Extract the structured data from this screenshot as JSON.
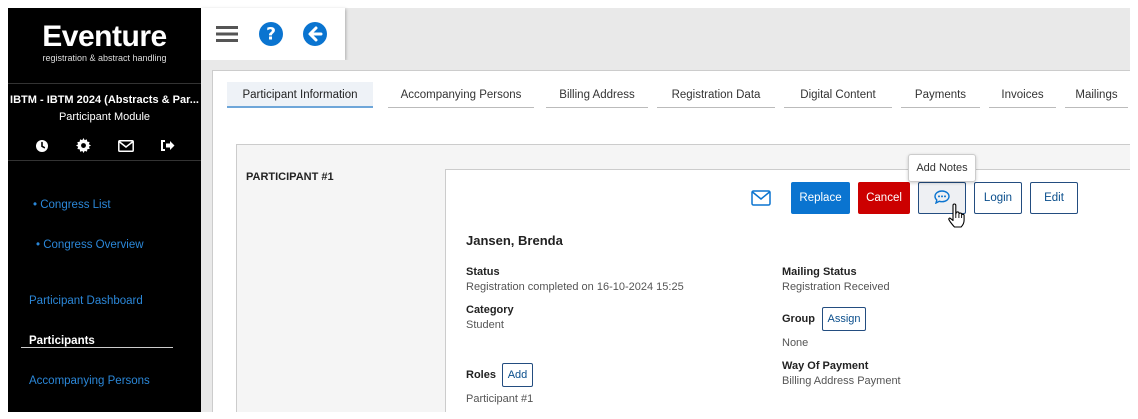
{
  "sidebar": {
    "logo_title": "Eventure",
    "logo_subtitle": "registration & abstract handling",
    "event_name": "IBTM - IBTM 2024 (Abstracts & Par...",
    "module_name": "Participant Module",
    "icons": [
      "clock-icon",
      "gear-icon",
      "mail-icon",
      "sign-out-icon"
    ],
    "links": {
      "congress_list": "• Congress List",
      "congress_overview": "• Congress Overview",
      "participant_dashboard": "Participant Dashboard",
      "participants": "Participants",
      "accompanying_persons": "Accompanying Persons"
    }
  },
  "toolbar": {
    "icons": [
      "menu-icon",
      "help-icon",
      "back-arrow-icon"
    ]
  },
  "tabs": [
    {
      "label": "Participant Information",
      "active": true
    },
    {
      "label": "Accompanying Persons",
      "active": false
    },
    {
      "label": "Billing Address",
      "active": false
    },
    {
      "label": "Registration Data",
      "active": false
    },
    {
      "label": "Digital Content",
      "active": false
    },
    {
      "label": "Payments",
      "active": false
    },
    {
      "label": "Invoices",
      "active": false
    },
    {
      "label": "Mailings",
      "active": false
    }
  ],
  "participant": {
    "section_label": "PARTICIPANT #1",
    "name": "Jansen, Brenda",
    "actions": {
      "replace": "Replace",
      "cancel": "Cancel",
      "login": "Login",
      "edit": "Edit",
      "notes_tooltip": "Add Notes"
    },
    "status_label": "Status",
    "status_value": "Registration completed on 16-10-2024 15:25",
    "mailing_status_label": "Mailing Status",
    "mailing_status_value": "Registration Received",
    "category_label": "Category",
    "category_value": "Student",
    "group_label": "Group",
    "group_button": "Assign",
    "group_value": "None",
    "way_of_payment_label": "Way Of Payment",
    "way_of_payment_value": "Billing Address Payment",
    "roles_label": "Roles",
    "roles_button": "Add",
    "roles_value": "Participant #1"
  },
  "colors": {
    "accent": "#0a74d0",
    "danger": "#cc0000",
    "sidebar_bg": "#000000",
    "link": "#2b87d8"
  }
}
